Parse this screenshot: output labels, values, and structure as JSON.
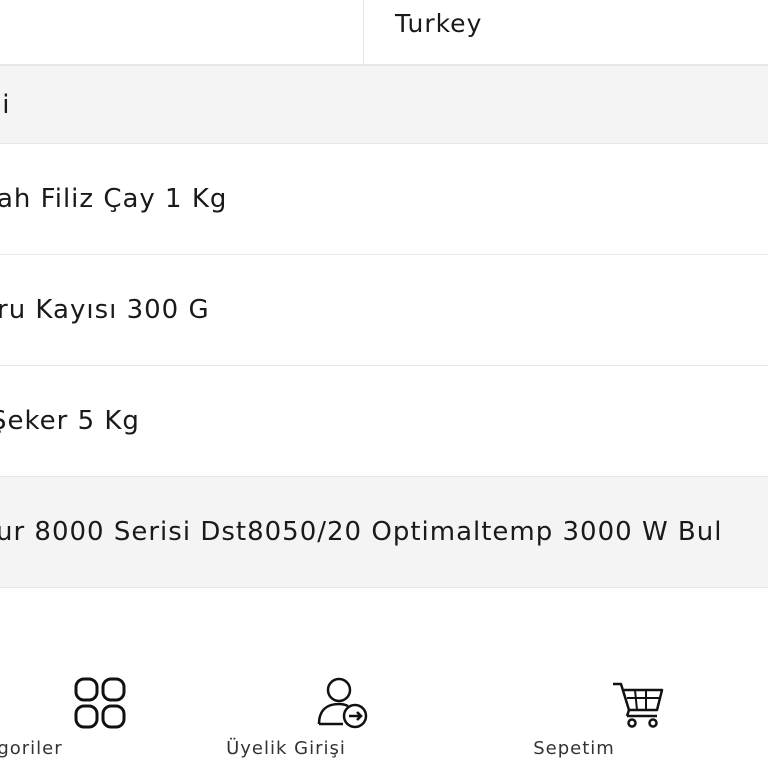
{
  "header": {
    "country": "Turkey"
  },
  "list": {
    "section_label": "li",
    "items": [
      "ah Filiz Çay 1 Kg",
      "ru Kayısı 300 G",
      " Şeker 5 Kg",
      "ur 8000 Serisi Dst8050/20 Optimaltemp 3000 W Bul"
    ]
  },
  "bottom_nav": {
    "categories_label": "goriler",
    "login_label": "Üyelik Girişi",
    "cart_label": "Sepetim"
  }
}
